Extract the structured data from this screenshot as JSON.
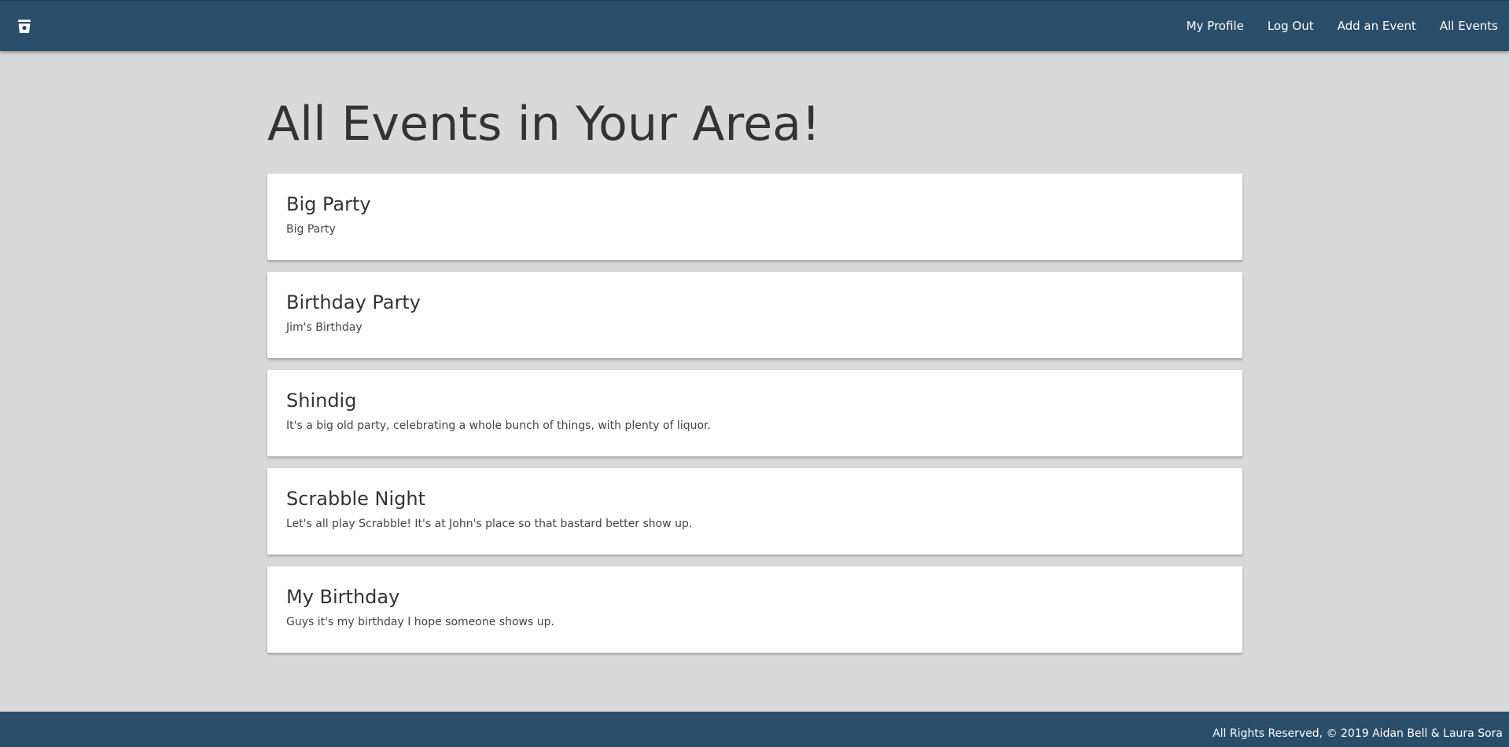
{
  "navbar": {
    "brand_icon": "cup-icon",
    "links": [
      {
        "label": "My Profile"
      },
      {
        "label": "Log Out"
      },
      {
        "label": "Add an Event"
      },
      {
        "label": "All Events"
      }
    ]
  },
  "main": {
    "title": "All Events in Your Area!",
    "events": [
      {
        "title": "Big Party",
        "description": "Big Party"
      },
      {
        "title": "Birthday Party",
        "description": "Jim's Birthday"
      },
      {
        "title": "Shindig",
        "description": "It's a big old party, celebrating a whole bunch of things, with plenty of liquor."
      },
      {
        "title": "Scrabble Night",
        "description": "Let's all play Scrabble! It's at John's place so that bastard better show up."
      },
      {
        "title": "My Birthday",
        "description": "Guys it's my birthday I hope someone shows up."
      }
    ]
  },
  "footer": {
    "text": "All Rights Reserved, © 2019 Aidan Bell & Laura Sora"
  },
  "colors": {
    "nav_background": "#2a4d69",
    "page_background": "#d9d9d9",
    "card_background": "#ffffff"
  }
}
